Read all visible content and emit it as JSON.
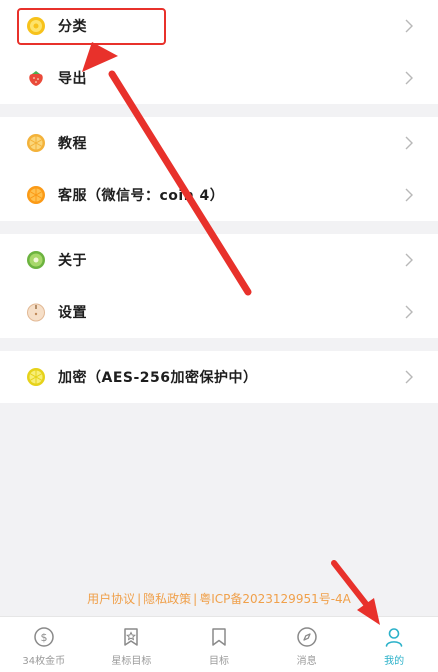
{
  "menu": {
    "group1": [
      {
        "label": "分类",
        "icon": "lemon-icon"
      },
      {
        "label": "导出",
        "icon": "strawberry-icon"
      }
    ],
    "group2": [
      {
        "label": "教程",
        "icon": "lemon-slice-icon"
      },
      {
        "label": "客服（微信号：coin 4）",
        "icon": "orange-icon"
      }
    ],
    "group3": [
      {
        "label": "关于",
        "icon": "kiwi-icon"
      },
      {
        "label": "设置",
        "icon": "pear-icon"
      }
    ],
    "group4": [
      {
        "label": "加密（AES-256加密保护中）",
        "icon": "lime-icon"
      }
    ]
  },
  "footer": {
    "user_agreement": "用户协议",
    "divider": "|",
    "privacy_policy": "隐私政策",
    "icp": "粤ICP备2023129951号-4A"
  },
  "tabbar": {
    "tabs": [
      {
        "label": "34枚金币",
        "icon": "coin-icon"
      },
      {
        "label": "星标目标",
        "icon": "star-badge-icon"
      },
      {
        "label": "目标",
        "icon": "bookmark-icon"
      },
      {
        "label": "消息",
        "icon": "compass-icon"
      },
      {
        "label": "我的",
        "icon": "user-icon"
      }
    ],
    "active_index": 4
  },
  "colors": {
    "accent": "#2bb1c9",
    "annotation": "#e8312b",
    "footer_link": "#f0a04a"
  }
}
